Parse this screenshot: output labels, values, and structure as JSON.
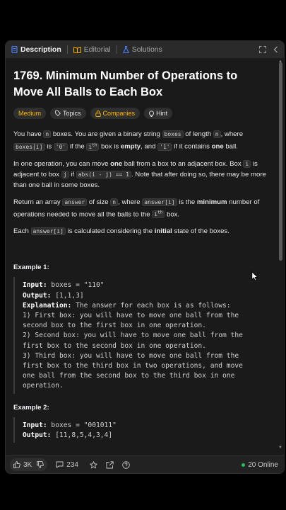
{
  "tabs": [
    {
      "label": "Description",
      "icon": "document-icon"
    },
    {
      "label": "Editorial",
      "icon": "book-icon"
    },
    {
      "label": "Solutions",
      "icon": "flask-icon"
    }
  ],
  "problem": {
    "title": "1769. Minimum Number of Operations to Move All Balls to Each Box",
    "chips": [
      "Medium",
      "Topics",
      "Companies",
      "Hint"
    ]
  },
  "p1": {
    "a": "You have ",
    "n": "n",
    "b": " boxes. You are given a binary string ",
    "boxes": "boxes",
    "c": " of length ",
    "n2": "n",
    "d": ", where ",
    "boxesi": "boxes[i]",
    "e": " is ",
    "zero": "'0'",
    "f": " if the ",
    "ith": "i",
    "th": "th",
    "g": " box is ",
    "empty": "empty",
    "h": ", and ",
    "one": "'1'",
    "i": " if it contains ",
    "oneb": "one",
    "j": " ball."
  },
  "p2": {
    "a": "In one operation, you can move ",
    "one": "one",
    "b": " ball from a box to an adjacent box. Box ",
    "i": "i",
    "c": " is adjacent to box ",
    "j": "j",
    "d": " if ",
    "abs": "abs(i - j) == 1",
    "e": ". Note that after doing so, there may be more than one ball in some boxes."
  },
  "p3": {
    "a": "Return an array ",
    "answer": "answer",
    "b": " of size ",
    "n": "n",
    "c": ", where ",
    "answeri": "answer[i]",
    "d": " is the ",
    "minimum": "minimum",
    "e": " number of operations needed to move all the balls to the ",
    "ith": "i",
    "th": "th",
    "f": " box."
  },
  "p4": {
    "a": "Each ",
    "answeri": "answer[i]",
    "b": " is calculated considering the ",
    "initial": "initial",
    "c": " state of the boxes."
  },
  "example1": {
    "title": "Example 1:",
    "input_label": "Input:",
    "input": " boxes = \"110\"",
    "output_label": "Output:",
    "output": " [1,1,3]",
    "expl_label": "Explanation:",
    "expl": " The answer for each box is as follows:",
    "lines": [
      "1) First box: you will have to move one ball from the",
      "second box to the first box in one operation.",
      "2) Second box: you will have to move one ball from the",
      "first box to the second box in one operation.",
      "3) Third box: you will have to move one ball from the",
      "first box to the third box in two operations, and move",
      "one ball from the second box to the third box in one",
      "operation."
    ]
  },
  "example2": {
    "title": "Example 2:",
    "input_label": "Input:",
    "input": " boxes = \"001011\"",
    "output_label": "Output:",
    "output": " [11,8,5,4,3,4]"
  },
  "bottom": {
    "likes": "3K",
    "comments": "234",
    "online": "20 Online"
  },
  "colors": {
    "medium": "#ffb800",
    "online_dot": "#2cbb5d",
    "tab_active": "#4a7ef7"
  }
}
